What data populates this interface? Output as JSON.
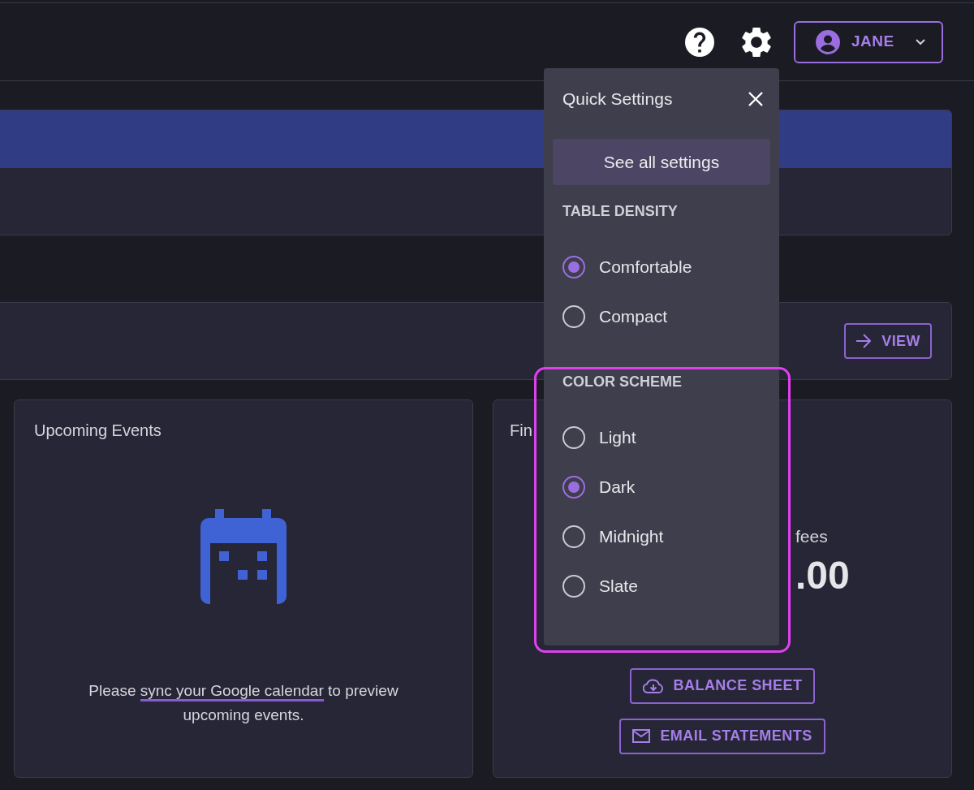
{
  "header": {
    "user_button": {
      "label": "JANE"
    }
  },
  "summary_card": {
    "view_button": "VIEW"
  },
  "upcoming_events": {
    "title": "Upcoming Events",
    "message_before": "Please",
    "link": "sync your Google calendar",
    "message_after": "to preview upcoming events."
  },
  "finance_card": {
    "title": "Fin",
    "fees_text": "fees",
    "amount_text": ".00",
    "buttons": [
      {
        "kind": "download",
        "label": "BALANCE SHEET"
      },
      {
        "kind": "email",
        "label": "EMAIL STATEMENTS"
      }
    ]
  },
  "quick_settings": {
    "title": "Quick Settings",
    "see_all_button": "See all settings",
    "sections": [
      {
        "heading": "TABLE DENSITY",
        "options": [
          {
            "label": "Comfortable",
            "selected": true
          },
          {
            "label": "Compact",
            "selected": false
          }
        ]
      },
      {
        "heading": "COLOR SCHEME",
        "options": [
          {
            "label": "Light",
            "selected": false
          },
          {
            "label": "Dark",
            "selected": true
          },
          {
            "label": "Midnight",
            "selected": false
          },
          {
            "label": "Slate",
            "selected": false
          }
        ]
      }
    ]
  }
}
